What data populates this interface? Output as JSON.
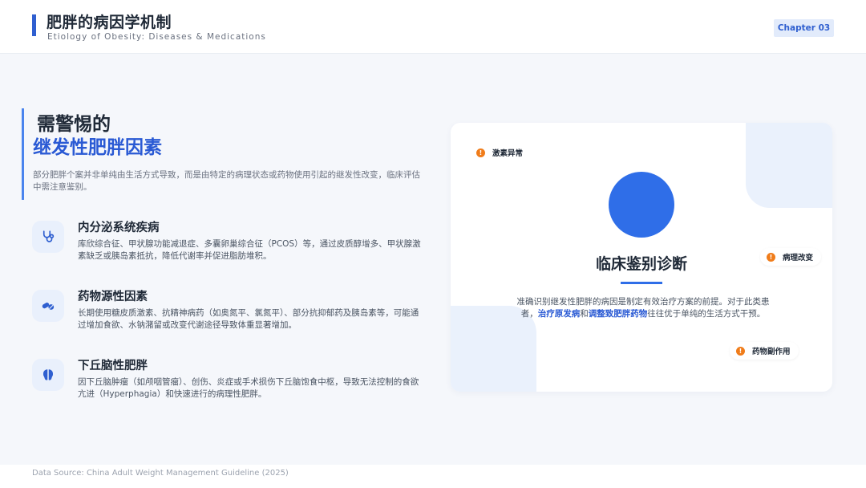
{
  "header": {
    "title": "肥胖的病因学机制",
    "subtitle": "Etiology of Obesity: Diseases & Medications",
    "chapter": "Chapter 03"
  },
  "intro": {
    "line1": "需警惕的",
    "line2": "继发性肥胖因素",
    "description": "部分肥胖个案并非单纯由生活方式导致，而是由特定的病理状态或药物使用引起的继发性改变，临床评估中需注意鉴别。"
  },
  "features": [
    {
      "icon": "stethoscope-icon",
      "title": "内分泌系统疾病",
      "description": "库欣综合征、甲状腺功能减退症、多囊卵巢综合征（PCOS）等，通过皮质醇增多、甲状腺激素缺乏或胰岛素抵抗，降低代谢率并促进脂肪堆积。"
    },
    {
      "icon": "pills-icon",
      "title": "药物源性因素",
      "description": "长期使用糖皮质激素、抗精神病药（如奥氮平、氯氮平）、部分抗抑郁药及胰岛素等，可能通过增加食欲、水钠潴留或改变代谢途径导致体重显著增加。"
    },
    {
      "icon": "brain-icon",
      "title": "下丘脑性肥胖",
      "description": "因下丘脑肿瘤（如颅咽管瘤）、创伤、炎症或手术损伤下丘脑饱食中枢，导致无法控制的食欲亢进（Hyperphagia）和快速进行的病理性肥胖。"
    }
  ],
  "card": {
    "title": "临床鉴别诊断",
    "desc_part1": "准确识别继发性肥胖的病因是制定有效治疗方案的前提。对于此类患者，",
    "highlight1": "治疗原发病",
    "desc_part2": "和",
    "highlight2": "调整致肥胖药物",
    "desc_part3": "往往优于单纯的生活方式干预。",
    "tags": [
      {
        "label": "激素异常",
        "icon": "!"
      },
      {
        "label": "病理改变",
        "icon": "!"
      },
      {
        "label": "药物副作用",
        "icon": "!"
      }
    ]
  },
  "footer": {
    "source": "Data Source: China Adult Weight Management Guideline (2025)"
  },
  "colors": {
    "accent": "#2f5fd0",
    "circle": "#2f6ee8",
    "warning": "#f07c1a",
    "background": "#f5f7fb"
  }
}
